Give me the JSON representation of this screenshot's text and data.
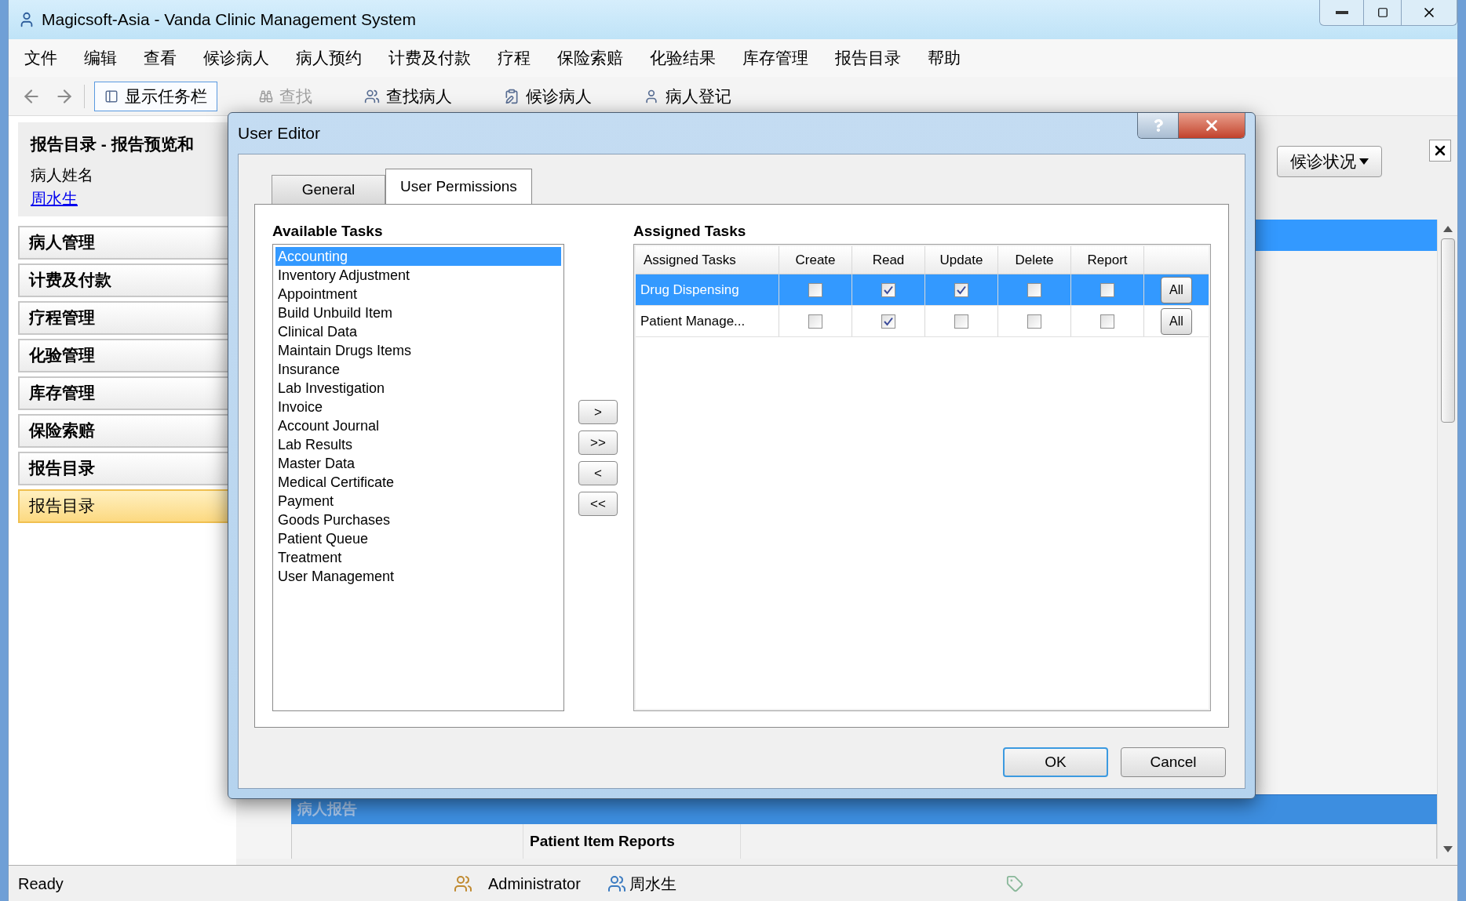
{
  "window": {
    "title": "Magicsoft-Asia - Vanda Clinic Management System"
  },
  "menu": [
    "文件",
    "编辑",
    "查看",
    "候诊病人",
    "病人预约",
    "计费及付款",
    "疗程",
    "保险索赔",
    "化验结果",
    "库存管理",
    "报告目录",
    "帮助"
  ],
  "toolbar": [
    {
      "label": "显示任务栏",
      "disabled": false,
      "selected": true
    },
    {
      "label": "查找",
      "disabled": true,
      "selected": false
    },
    {
      "label": "查找病人",
      "disabled": false,
      "selected": false
    },
    {
      "label": "候诊病人",
      "disabled": false,
      "selected": false
    },
    {
      "label": "病人登记",
      "disabled": false,
      "selected": false
    }
  ],
  "sidebar": {
    "title": "报告目录 - 报告预览和",
    "patient_label": "病人姓名",
    "patient_name": "周水生",
    "sections": [
      {
        "label": "病人管理",
        "selected": false
      },
      {
        "label": "计费及付款",
        "selected": false
      },
      {
        "label": "疗程管理",
        "selected": false
      },
      {
        "label": "化验管理",
        "selected": false
      },
      {
        "label": "库存管理",
        "selected": false
      },
      {
        "label": "保险索赔",
        "selected": false
      },
      {
        "label": "报告目录",
        "selected": false
      },
      {
        "label": "报告目录",
        "selected": true
      }
    ]
  },
  "content": {
    "status_button": "候诊状况",
    "report_grid": {
      "group": "病人报告",
      "rows": [
        {
          "column_2": "Patient Item Reports"
        }
      ]
    }
  },
  "dialog": {
    "title": "User Editor",
    "tabs": [
      {
        "label": "General",
        "selected": false
      },
      {
        "label": "User Permissions",
        "selected": true
      }
    ],
    "available": {
      "title": "Available Tasks",
      "items": [
        {
          "label": "Accounting",
          "selected": true
        },
        {
          "label": "Inventory Adjustment",
          "selected": false
        },
        {
          "label": "Appointment",
          "selected": false
        },
        {
          "label": "Build Unbuild Item",
          "selected": false
        },
        {
          "label": "Clinical Data",
          "selected": false
        },
        {
          "label": "Maintain Drugs Items",
          "selected": false
        },
        {
          "label": "Insurance",
          "selected": false
        },
        {
          "label": "Lab Investigation",
          "selected": false
        },
        {
          "label": "Invoice",
          "selected": false
        },
        {
          "label": "Account Journal",
          "selected": false
        },
        {
          "label": "Lab Results",
          "selected": false
        },
        {
          "label": "Master Data",
          "selected": false
        },
        {
          "label": "Medical Certificate",
          "selected": false
        },
        {
          "label": "Payment",
          "selected": false
        },
        {
          "label": "Goods Purchases",
          "selected": false
        },
        {
          "label": "Patient Queue",
          "selected": false
        },
        {
          "label": "Treatment",
          "selected": false
        },
        {
          "label": "User Management",
          "selected": false
        }
      ]
    },
    "move_buttons": [
      ">",
      ">>",
      "<",
      "<<"
    ],
    "assigned": {
      "title": "Assigned Tasks",
      "columns": [
        "Assigned Tasks",
        "Create",
        "Read",
        "Update",
        "Delete",
        "Report"
      ],
      "rows": [
        {
          "task": "Drug Dispensing",
          "selected": true,
          "checks": [
            false,
            true,
            true,
            false,
            false
          ],
          "all": "All"
        },
        {
          "task": "Patient Manage...",
          "selected": false,
          "checks": [
            false,
            true,
            false,
            false,
            false
          ],
          "all": "All"
        }
      ]
    },
    "buttons": [
      {
        "label": "OK",
        "default": true
      },
      {
        "label": "Cancel",
        "default": false
      }
    ]
  },
  "status_bar": {
    "text": "Ready",
    "user": "Administrator",
    "patient": "周水生"
  }
}
